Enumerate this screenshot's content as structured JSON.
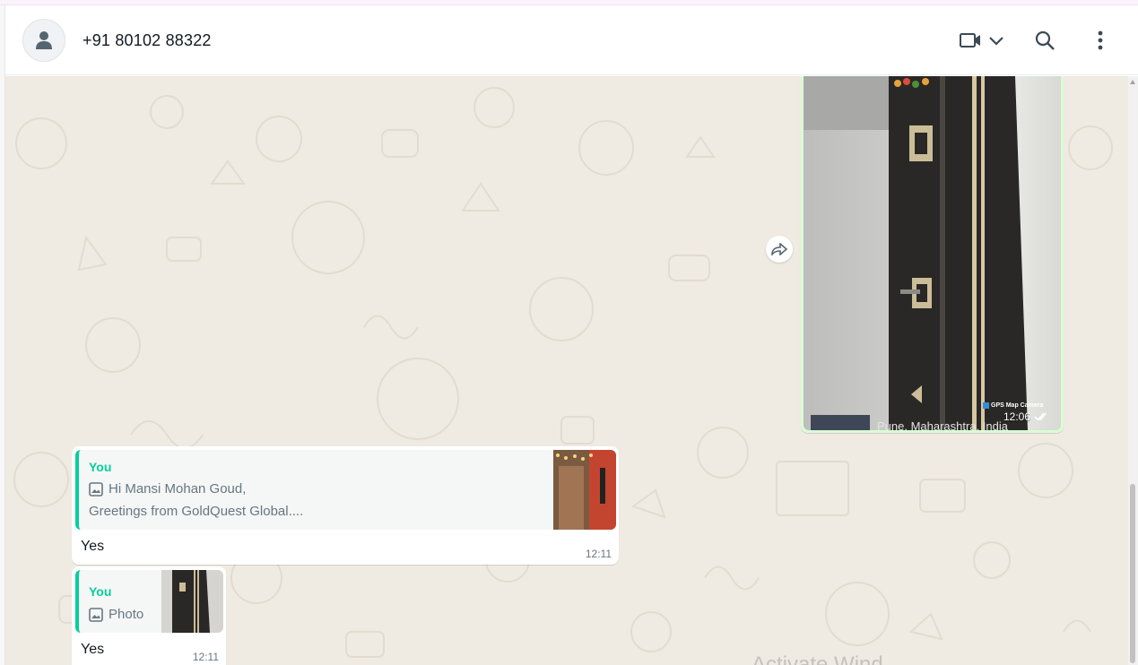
{
  "contact": {
    "name": "+91 80102 88322"
  },
  "header": {
    "icons": [
      "video-call-icon",
      "chevron-down-icon",
      "search-icon",
      "menu-icon"
    ]
  },
  "messages": {
    "photo": {
      "time": "12:06",
      "geo_tag": "GPS Map Camera",
      "location": "Pune, Maharashtra, India"
    },
    "reply1": {
      "quote_author": "You",
      "quote_line1": "Hi Mansi Mohan Goud,",
      "quote_line2": "Greetings from GoldQuest Global....",
      "text": "Yes",
      "time": "12:11"
    },
    "reply2": {
      "quote_author": "You",
      "quote_line1": "Photo",
      "text": "Yes",
      "time": "12:11"
    }
  },
  "watermark": "Activate Wind"
}
